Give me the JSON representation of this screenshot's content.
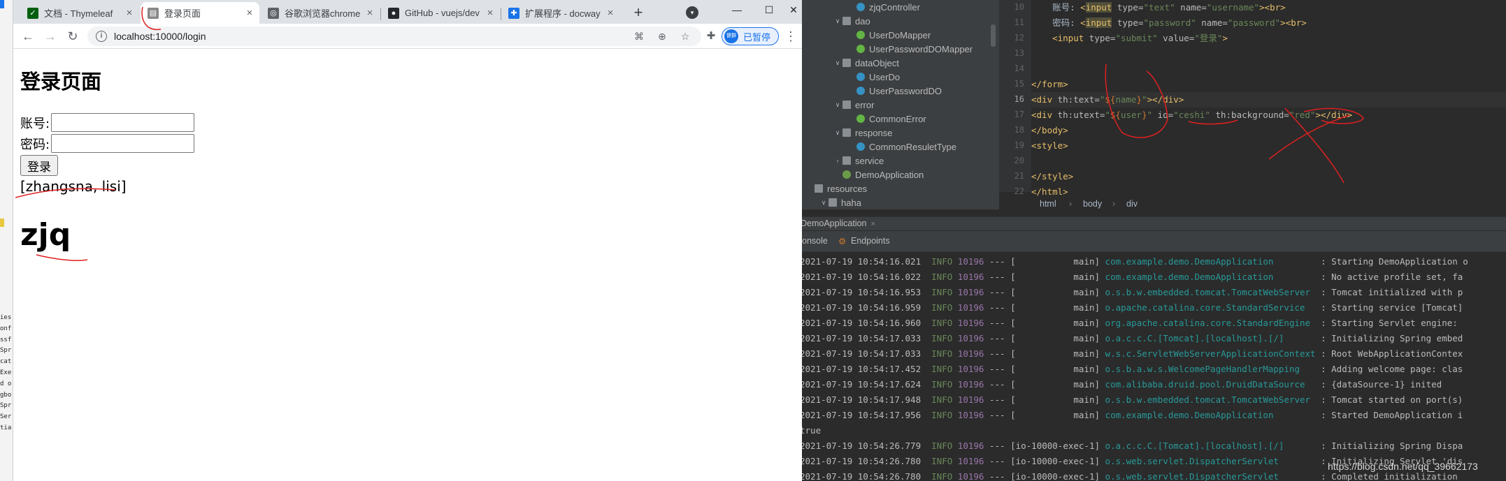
{
  "left_strip": {
    "rows": [
      "ies",
      "onf",
      "ssf",
      "Spr",
      "cat",
      "Exe",
      "d o",
      "gbo",
      "Spr",
      "Ser",
      "tia"
    ]
  },
  "browser": {
    "tabs": [
      {
        "title": "文档 - Thymeleaf",
        "icon": "thymeleaf-icon",
        "color": "#005f0f",
        "active": false
      },
      {
        "title": "登录页面",
        "icon": "page-icon",
        "color": "#888888",
        "active": true
      },
      {
        "title": "谷歌浏览器chrome",
        "icon": "chrome-icon",
        "color": "#5f6368",
        "active": false
      },
      {
        "title": "GitHub - vuejs/dev",
        "icon": "github-icon",
        "color": "#24292e",
        "active": false
      },
      {
        "title": "扩展程序 - docway",
        "icon": "puzzle-icon",
        "color": "#1a73e8",
        "active": false
      }
    ],
    "tab_close": "×",
    "new_tab": "+",
    "url": "localhost:10000/login",
    "sync_avatar": "健群",
    "sync_label": "已暂停"
  },
  "page": {
    "title": "登录页面",
    "username_label": "账号:",
    "password_label": "密码:",
    "submit_label": "登录",
    "name_list": "[zhangsna, lisi]",
    "user": "zjq"
  },
  "ide": {
    "tree": [
      {
        "label": "zjqController",
        "type": "class",
        "depth": 3,
        "arrow": ""
      },
      {
        "label": "dao",
        "type": "folder",
        "depth": 2,
        "arrow": "∨"
      },
      {
        "label": "UserDoMapper",
        "type": "iface",
        "depth": 3,
        "arrow": ""
      },
      {
        "label": "UserPasswordDOMapper",
        "type": "iface",
        "depth": 3,
        "arrow": ""
      },
      {
        "label": "dataObject",
        "type": "folder",
        "depth": 2,
        "arrow": "∨"
      },
      {
        "label": "UserDo",
        "type": "class",
        "depth": 3,
        "arrow": ""
      },
      {
        "label": "UserPasswordDO",
        "type": "class",
        "depth": 3,
        "arrow": ""
      },
      {
        "label": "error",
        "type": "folder",
        "depth": 2,
        "arrow": "∨"
      },
      {
        "label": "CommonError",
        "type": "iface",
        "depth": 3,
        "arrow": ""
      },
      {
        "label": "response",
        "type": "folder",
        "depth": 2,
        "arrow": "∨"
      },
      {
        "label": "CommonResuletType",
        "type": "class",
        "depth": 3,
        "arrow": ""
      },
      {
        "label": "service",
        "type": "folder",
        "depth": 2,
        "arrow": "›"
      },
      {
        "label": "DemoApplication",
        "type": "spring",
        "depth": 2,
        "arrow": ""
      },
      {
        "label": "resources",
        "type": "folder",
        "depth": 0,
        "arrow": ""
      },
      {
        "label": "haha",
        "type": "folder",
        "depth": 1,
        "arrow": "∨"
      }
    ],
    "line_numbers": [
      "10",
      "11",
      "12",
      "13",
      "14",
      "15",
      "16",
      "17",
      "18",
      "19",
      "20",
      "21",
      "22"
    ],
    "current_line": "16",
    "code": [
      [
        {
          "c": "t-txt",
          "t": "    账号: "
        },
        {
          "c": "t-tag",
          "t": "<"
        },
        {
          "c": "t-tag t-hi",
          "t": "input"
        },
        {
          "c": "t-attr",
          "t": " type="
        },
        {
          "c": "t-val",
          "t": "\"text\""
        },
        {
          "c": "t-attr",
          "t": " name="
        },
        {
          "c": "t-val",
          "t": "\"username\""
        },
        {
          "c": "t-tag",
          "t": "><br>"
        }
      ],
      [
        {
          "c": "t-txt",
          "t": "    密码: "
        },
        {
          "c": "t-tag",
          "t": "<"
        },
        {
          "c": "t-tag t-hi",
          "t": "input"
        },
        {
          "c": "t-attr",
          "t": " type="
        },
        {
          "c": "t-val",
          "t": "\"password\""
        },
        {
          "c": "t-attr",
          "t": " name="
        },
        {
          "c": "t-val",
          "t": "\"password\""
        },
        {
          "c": "t-tag",
          "t": "><br>"
        }
      ],
      [
        {
          "c": "t-tag",
          "t": "    <input"
        },
        {
          "c": "t-attr",
          "t": " type="
        },
        {
          "c": "t-val",
          "t": "\"submit\""
        },
        {
          "c": "t-attr",
          "t": " value="
        },
        {
          "c": "t-val",
          "t": "\"登录\""
        },
        {
          "c": "t-tag",
          "t": ">"
        }
      ],
      [],
      [],
      [
        {
          "c": "t-tag",
          "t": "</form>"
        }
      ],
      [
        {
          "c": "t-tag",
          "t": "<div"
        },
        {
          "c": "t-attr",
          "t": " th:text="
        },
        {
          "c": "t-val",
          "t": "\""
        },
        {
          "c": "t-expr",
          "t": "${"
        },
        {
          "c": "t-val",
          "t": "name"
        },
        {
          "c": "t-expr",
          "t": "}"
        },
        {
          "c": "t-val",
          "t": "\""
        },
        {
          "c": "t-tag",
          "t": "></div>"
        }
      ],
      [
        {
          "c": "t-tag",
          "t": "<div"
        },
        {
          "c": "t-attr",
          "t": " th:utext="
        },
        {
          "c": "t-val",
          "t": "\""
        },
        {
          "c": "t-expr",
          "t": "${"
        },
        {
          "c": "t-val",
          "t": "user"
        },
        {
          "c": "t-expr",
          "t": "}"
        },
        {
          "c": "t-val",
          "t": "\""
        },
        {
          "c": "t-attr",
          "t": " id="
        },
        {
          "c": "t-val",
          "t": "\"ceshi\""
        },
        {
          "c": "t-attr",
          "t": " th:background="
        },
        {
          "c": "t-val",
          "t": "\"red\""
        },
        {
          "c": "t-tag",
          "t": "></div>"
        }
      ],
      [
        {
          "c": "t-tag",
          "t": "</body>"
        }
      ],
      [
        {
          "c": "t-tag",
          "t": "<style>"
        }
      ],
      [],
      [
        {
          "c": "t-tag",
          "t": "</style>"
        }
      ],
      [
        {
          "c": "t-tag",
          "t": "</html>"
        }
      ]
    ],
    "breadcrumb": [
      "html",
      "body",
      "div"
    ],
    "run_tab": "DemoApplication",
    "run_tab_close": "×",
    "console_tabs": [
      "onsole",
      "Endpoints"
    ],
    "log": [
      {
        "d": "2021-07-19 10:54:16.021",
        "lv": "INFO",
        "pid": "10196",
        "dash": "---",
        "th": "[           main]",
        "lg": "com.example.demo.DemoApplication        ",
        "m": ": Starting DemoApplication o"
      },
      {
        "d": "2021-07-19 10:54:16.022",
        "lv": "INFO",
        "pid": "10196",
        "dash": "---",
        "th": "[           main]",
        "lg": "com.example.demo.DemoApplication        ",
        "m": ": No active profile set, fa"
      },
      {
        "d": "2021-07-19 10:54:16.953",
        "lv": "INFO",
        "pid": "10196",
        "dash": "---",
        "th": "[           main]",
        "lg": "o.s.b.w.embedded.tomcat.TomcatWebServer ",
        "m": ": Tomcat initialized with p"
      },
      {
        "d": "2021-07-19 10:54:16.959",
        "lv": "INFO",
        "pid": "10196",
        "dash": "---",
        "th": "[           main]",
        "lg": "o.apache.catalina.core.StandardService  ",
        "m": ": Starting service [Tomcat]"
      },
      {
        "d": "2021-07-19 10:54:16.960",
        "lv": "INFO",
        "pid": "10196",
        "dash": "---",
        "th": "[           main]",
        "lg": "org.apache.catalina.core.StandardEngine ",
        "m": ": Starting Servlet engine:"
      },
      {
        "d": "2021-07-19 10:54:17.033",
        "lv": "INFO",
        "pid": "10196",
        "dash": "---",
        "th": "[           main]",
        "lg": "o.a.c.c.C.[Tomcat].[localhost].[/]      ",
        "m": ": Initializing Spring embed"
      },
      {
        "d": "2021-07-19 10:54:17.033",
        "lv": "INFO",
        "pid": "10196",
        "dash": "---",
        "th": "[           main]",
        "lg": "w.s.c.ServletWebServerApplicationContext",
        "m": ": Root WebApplicationContex"
      },
      {
        "d": "2021-07-19 10:54:17.452",
        "lv": "INFO",
        "pid": "10196",
        "dash": "---",
        "th": "[           main]",
        "lg": "o.s.b.a.w.s.WelcomePageHandlerMapping   ",
        "m": ": Adding welcome page: clas"
      },
      {
        "d": "2021-07-19 10:54:17.624",
        "lv": "INFO",
        "pid": "10196",
        "dash": "---",
        "th": "[           main]",
        "lg": "com.alibaba.druid.pool.DruidDataSource  ",
        "m": ": {dataSource-1} inited"
      },
      {
        "d": "2021-07-19 10:54:17.948",
        "lv": "INFO",
        "pid": "10196",
        "dash": "---",
        "th": "[           main]",
        "lg": "o.s.b.w.embedded.tomcat.TomcatWebServer ",
        "m": ": Tomcat started on port(s)"
      },
      {
        "d": "2021-07-19 10:54:17.956",
        "lv": "INFO",
        "pid": "10196",
        "dash": "---",
        "th": "[           main]",
        "lg": "com.example.demo.DemoApplication        ",
        "m": ": Started DemoApplication i"
      },
      {
        "d": "true",
        "lv": "",
        "pid": "",
        "dash": "",
        "th": "",
        "lg": "",
        "m": ""
      },
      {
        "d": "2021-07-19 10:54:26.779",
        "lv": "INFO",
        "pid": "10196",
        "dash": "---",
        "th": "[io-10000-exec-1]",
        "lg": "o.a.c.c.C.[Tomcat].[localhost].[/]      ",
        "m": ": Initializing Spring Dispa"
      },
      {
        "d": "2021-07-19 10:54:26.780",
        "lv": "INFO",
        "pid": "10196",
        "dash": "---",
        "th": "[io-10000-exec-1]",
        "lg": "o.s.web.servlet.DispatcherServlet       ",
        "m": ": Initializing Servlet 'dis"
      },
      {
        "d": "2021-07-19 10:54:26.780",
        "lv": "INFO",
        "pid": "10196",
        "dash": "---",
        "th": "[io-10000-exec-1]",
        "lg": "o.s.web.servlet.DispatcherServlet       ",
        "m": ": Completed initialization"
      }
    ]
  },
  "watermark": "https://blog.csdn.net/qq_39662173",
  "colors": {
    "annotation_red": "#e02020",
    "ide_bg": "#2b2b2b",
    "log_logger": "#299999",
    "log_pid": "#9876aa",
    "log_info": "#6a8759"
  }
}
